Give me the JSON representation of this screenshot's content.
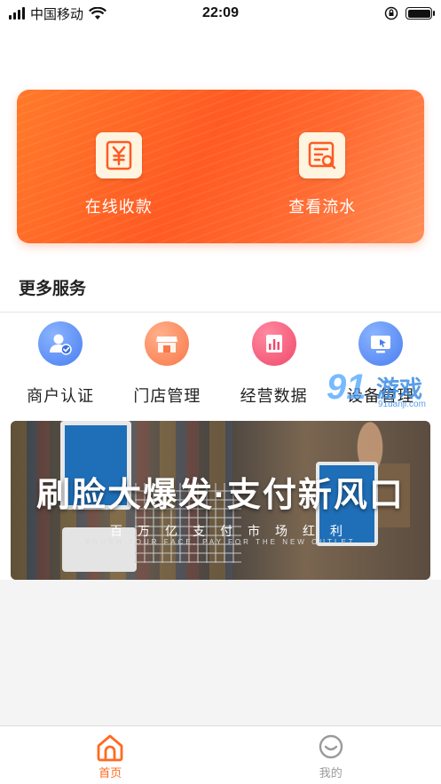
{
  "status_bar": {
    "carrier": "中国移动",
    "time": "22:09"
  },
  "hero": {
    "actions": [
      {
        "label": "在线收款",
        "icon": "yuan-receipt-icon"
      },
      {
        "label": "查看流水",
        "icon": "ledger-search-icon"
      }
    ]
  },
  "more_services": {
    "title": "更多服务",
    "items": [
      {
        "label": "商户认证",
        "icon": "merchant-verify-icon",
        "color": "#5b8ff9"
      },
      {
        "label": "门店管理",
        "icon": "store-icon",
        "color": "#ff8a65"
      },
      {
        "label": "经营数据",
        "icon": "bar-chart-icon",
        "color": "#f25a7a"
      },
      {
        "label": "设备管理",
        "icon": "device-icon",
        "color": "#5b8ff9"
      }
    ]
  },
  "watermark": {
    "number": "91",
    "text": "游戏",
    "url": "91danji.com"
  },
  "banner": {
    "headline": "刷脸大爆发·支付新风口",
    "subline": "百万亿支付市场红利",
    "subline_en": "BRUSH YOUR FACE, PAY FOR THE NEW OUTLET"
  },
  "tabbar": {
    "tabs": [
      {
        "label": "首页",
        "icon": "home-icon",
        "active": true
      },
      {
        "label": "我的",
        "icon": "profile-icon",
        "active": false
      }
    ]
  },
  "colors": {
    "accent": "#ff6a1f",
    "hero_gradient_start": "#ff7a2a",
    "hero_gradient_end": "#ff8d55"
  }
}
